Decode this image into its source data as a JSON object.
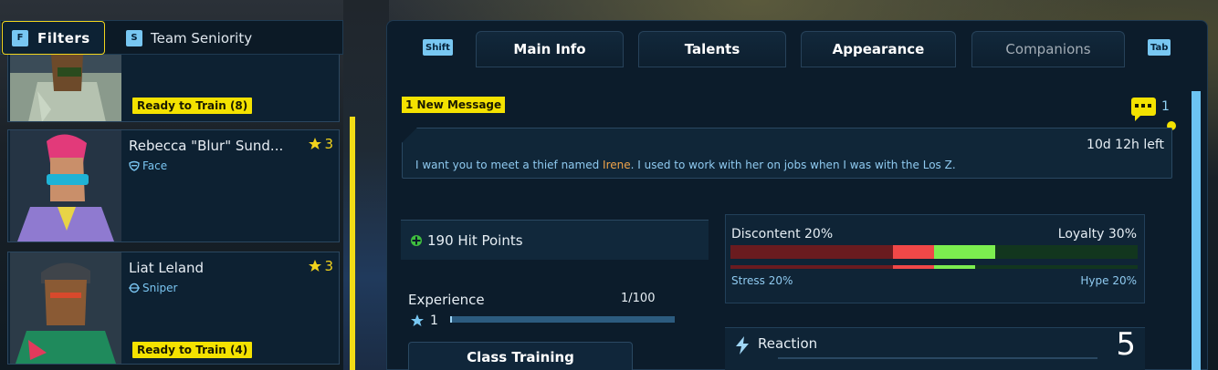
{
  "filters": {
    "filters_key": "F",
    "filters_label": "Filters",
    "seniority_key": "S",
    "seniority_label": "Team Seniority"
  },
  "roster": [
    {
      "name": "",
      "role": "",
      "level": "",
      "train_badge": "Ready to Train (8)"
    },
    {
      "name": "Rebecca \"Blur\" Sund...",
      "role": "Face",
      "role_icon": "mask-icon",
      "level": "3",
      "train_badge": ""
    },
    {
      "name": "Liat Leland",
      "role": "Sniper",
      "role_icon": "crosshair-icon",
      "level": "3",
      "train_badge": "Ready to Train (4)"
    }
  ],
  "tabs": {
    "shift_key": "Shift",
    "tab_key": "Tab",
    "items": [
      {
        "label": "Main Info",
        "active": true
      },
      {
        "label": "Talents",
        "active": true
      },
      {
        "label": "Appearance",
        "active": true
      },
      {
        "label": "Companions",
        "active": false
      }
    ]
  },
  "message": {
    "badge": "1 New Message",
    "count": "1",
    "time_left": "10d 12h left",
    "text_before": "I want you to meet a thief named ",
    "highlight": "Irene",
    "text_after": ". I used to work with her on jobs when I was with the Los Z."
  },
  "stats": {
    "hit_points": "190 Hit Points",
    "experience_label": "Experience",
    "experience_count": "1/100",
    "experience_progress": 0.01,
    "level": "1",
    "class_training": "Class Training",
    "discontent": "Discontent 20%",
    "loyalty": "Loyalty 30%",
    "stress": "Stress 20%",
    "hype": "Hype 20%",
    "reaction_label": "Reaction",
    "reaction_value": "5"
  },
  "colors": {
    "accent_yellow": "#f4e200",
    "accent_blue": "#78c7f2",
    "discontent_red": "#f04848",
    "loyalty_green": "#7cee4f"
  }
}
